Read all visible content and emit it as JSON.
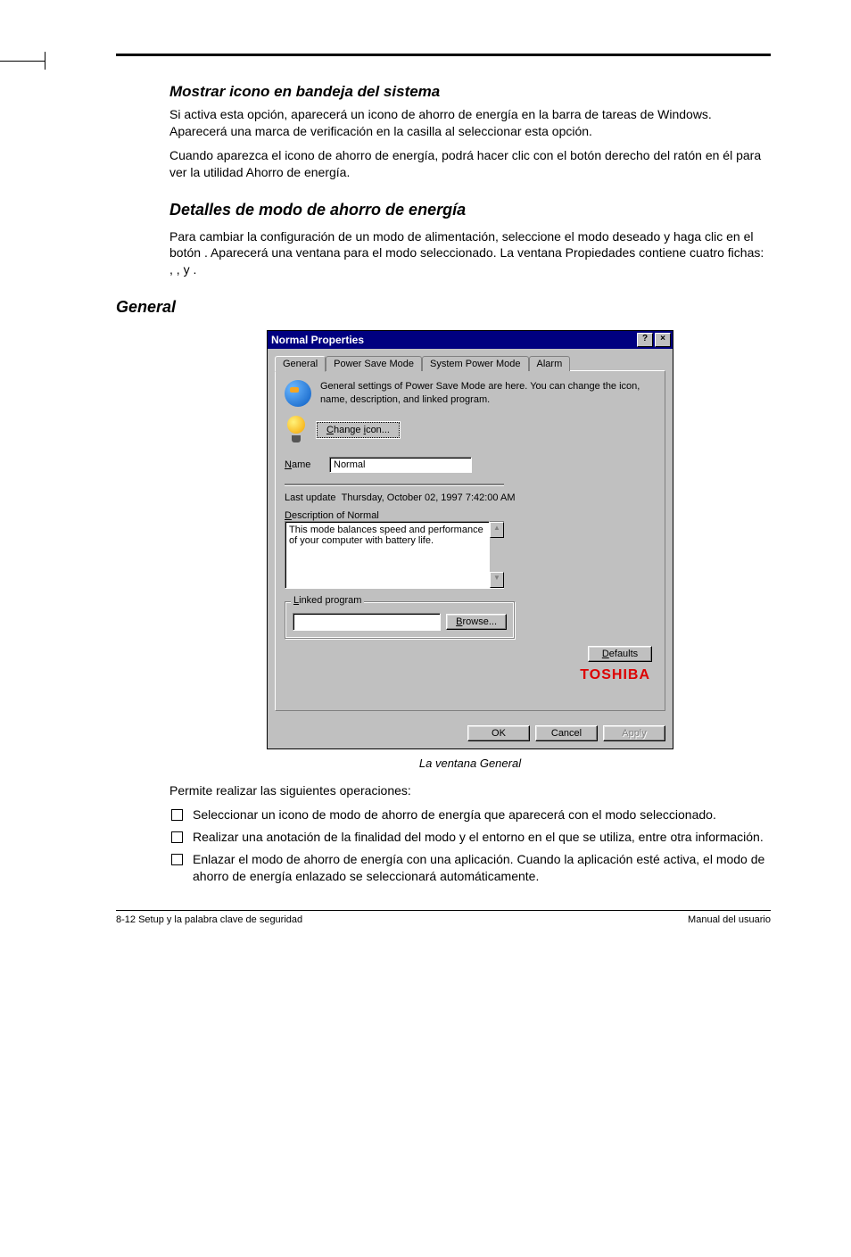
{
  "headings": {
    "h1": "Mostrar icono en bandeja del sistema",
    "h2": "Detalles de modo de ahorro de energía",
    "h3": "General"
  },
  "paragraphs": {
    "p1": "Si activa esta opción, aparecerá un icono de ahorro de energía en la barra de tareas de Windows. Aparecerá una marca de verificación en la casilla al seleccionar esta opción.",
    "p2": "Cuando aparezca el icono de ahorro de energía, podrá hacer clic con el botón derecho del ratón en él para ver la utilidad Ahorro de energía.",
    "p3a": "Para cambiar la configuración de un modo de alimentación, seleccione el modo deseado y haga clic en el botón ",
    "p3b": ". Aparecerá una ventana ",
    "p3c": " para el modo seleccionado. La ventana Propiedades contiene cuatro fichas: ",
    "comma": ", ",
    "p3y": " y ",
    "period": ".",
    "after_list_intro": "Permite realizar las siguientes operaciones:"
  },
  "dialog": {
    "title": "Normal Properties",
    "help_btn": "?",
    "close_btn": "×",
    "tabs": [
      "General",
      "Power Save Mode",
      "System Power Mode",
      "Alarm"
    ],
    "intro": "General settings of Power Save Mode are here. You can change the icon, name, description, and linked program.",
    "change_icon": "Change icon...",
    "name_label": "Name",
    "name_value": "Normal",
    "last_update_label": "Last update",
    "last_update_value": "Thursday, October 02, 1997 7:42:00 AM",
    "desc_label": "Description of Normal",
    "desc_value": "This mode balances speed and performance of your computer with battery life.",
    "linked_label": "Linked program",
    "browse_btn": "Browse...",
    "defaults_btn": "Defaults",
    "brand": "TOSHIBA",
    "ok_btn": "OK",
    "cancel_btn": "Cancel",
    "apply_btn": "Apply"
  },
  "caption": "La ventana General",
  "bullets": {
    "b1": "Seleccionar un icono de modo de ahorro de energía que aparecerá con el modo seleccionado.",
    "b2": "Realizar una anotación de la finalidad del modo y el entorno en el que se utiliza, entre otra información.",
    "b3": "Enlazar el modo de ahorro de energía con una aplicación. Cuando la aplicación esté activa, el modo de ahorro de energía enlazado se seleccionará automáticamente."
  },
  "footer": {
    "left": "8-12  Setup y la palabra clave de seguridad",
    "right": "Manual del usuario"
  }
}
